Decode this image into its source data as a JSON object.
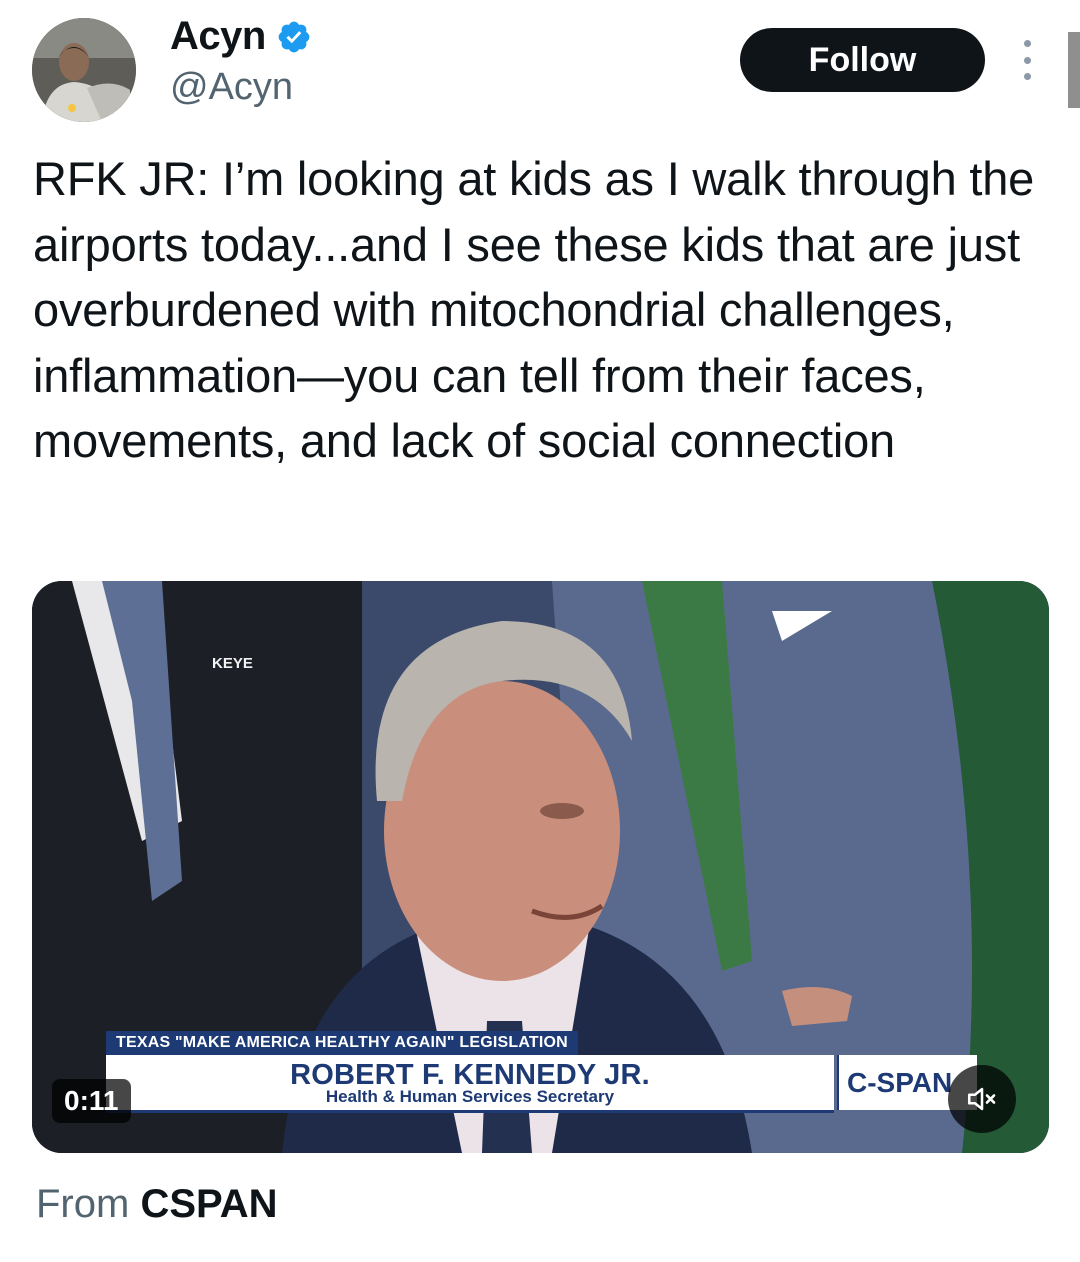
{
  "author": {
    "display_name": "Acyn",
    "handle": "@Acyn",
    "verified_icon": "verified-badge-icon",
    "avatar_icon": "profile-avatar"
  },
  "actions": {
    "follow_label": "Follow",
    "more_icon": "more-vertical-icon"
  },
  "tweet": {
    "text": "RFK JR: I’m looking at kids as I walk through the airports today...and I see these kids that are just overburdened with mitochondrial challenges, inflammation—you can tell from their faces, movements, and lack of social connection"
  },
  "media": {
    "type": "video",
    "duration": "0:11",
    "mute_icon": "volume-muted-icon",
    "overlay": {
      "podium_sign": "KEYE",
      "topic": "TEXAS \"MAKE AMERICA HEALTHY AGAIN\" LEGISLATION",
      "name": "ROBERT F. KENNEDY JR.",
      "title": "Health & Human Services Secretary",
      "network": "C-SPAN"
    }
  },
  "source": {
    "prefix": "From",
    "name": "CSPAN"
  },
  "colors": {
    "text": "#0f1419",
    "secondary_text": "#536471",
    "verified": "#1d9bf0",
    "follow_bg": "#0f1419",
    "cspan_blue": "#1d3a74"
  }
}
